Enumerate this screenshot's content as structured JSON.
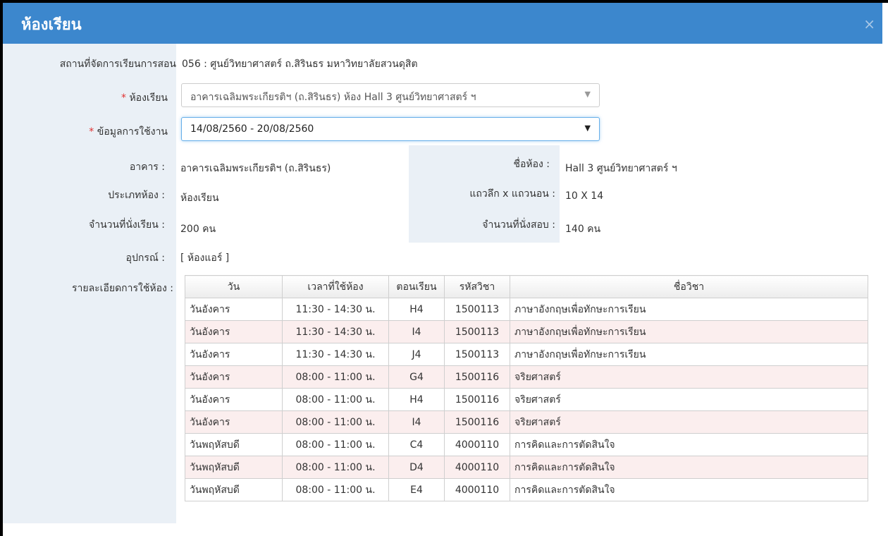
{
  "window": {
    "title": "ห้องเรียน",
    "close": "×"
  },
  "venue": {
    "label": "สถานที่จัดการเรียนการสอน",
    "value": "056 : ศูนย์วิทยาศาสตร์ ถ.สิรินธร มหาวิทยาลัยสวนดุสิต"
  },
  "room_select": {
    "required_mark": "*",
    "label": "ห้องเรียน",
    "value": "อาคารเฉลิมพระเกียรติฯ (ถ.สิรินธร) ห้อง Hall 3 ศูนย์วิทยาศาสตร์ ฯ"
  },
  "usage_select": {
    "required_mark": "*",
    "label": "ข้อมูลการใช้งาน",
    "value": "14/08/2560 - 20/08/2560"
  },
  "info": {
    "building_label": "อาคาร :",
    "building_value": "อาคารเฉลิมพระเกียรติฯ (ถ.สิรินธร)",
    "roomname_label": "ชื่อห้อง :",
    "roomname_value": "Hall 3 ศูนย์วิทยาศาสตร์ ฯ",
    "roomtype_label": "ประเภทห้อง :",
    "roomtype_value": "ห้องเรียน",
    "grid_label": "แถวลึก x แถวนอน :",
    "grid_value": "10 X 14",
    "seats_label": "จำนวนที่นั่งเรียน :",
    "seats_value": "200 คน",
    "exam_seats_label": "จำนวนที่นั่งสอบ :",
    "exam_seats_value": "140 คน",
    "equipment_label": "อุปกรณ์ :",
    "equipment_value": "[ ห้องแอร์ ]",
    "details_label": "รายละเอียดการใช้ห้อง :"
  },
  "table": {
    "headers": [
      "วัน",
      "เวลาที่ใช้ห้อง",
      "ตอนเรียน",
      "รหัสวิชา",
      "ชื่อวิชา"
    ],
    "rows": [
      [
        "วันอังคาร",
        "11:30 - 14:30 น.",
        "H4",
        "1500113",
        "ภาษาอังกฤษเพื่อทักษะการเรียน"
      ],
      [
        "วันอังคาร",
        "11:30 - 14:30 น.",
        "I4",
        "1500113",
        "ภาษาอังกฤษเพื่อทักษะการเรียน"
      ],
      [
        "วันอังคาร",
        "11:30 - 14:30 น.",
        "J4",
        "1500113",
        "ภาษาอังกฤษเพื่อทักษะการเรียน"
      ],
      [
        "วันอังคาร",
        "08:00 - 11:00 น.",
        "G4",
        "1500116",
        "จริยศาสตร์"
      ],
      [
        "วันอังคาร",
        "08:00 - 11:00 น.",
        "H4",
        "1500116",
        "จริยศาสตร์"
      ],
      [
        "วันอังคาร",
        "08:00 - 11:00 น.",
        "I4",
        "1500116",
        "จริยศาสตร์"
      ],
      [
        "วันพฤหัสบดี",
        "08:00 - 11:00 น.",
        "C4",
        "4000110",
        "การคิดและการตัดสินใจ"
      ],
      [
        "วันพฤหัสบดี",
        "08:00 - 11:00 น.",
        "D4",
        "4000110",
        "การคิดและการตัดสินใจ"
      ],
      [
        "วันพฤหัสบดี",
        "08:00 - 11:00 น.",
        "E4",
        "4000110",
        "การคิดและการตัดสินใจ"
      ]
    ]
  },
  "colors": {
    "header_bar": "#3c87cd",
    "label_bg": "#eaf0f6",
    "row_stripe": "#fbeeee",
    "required": "#e03030"
  }
}
